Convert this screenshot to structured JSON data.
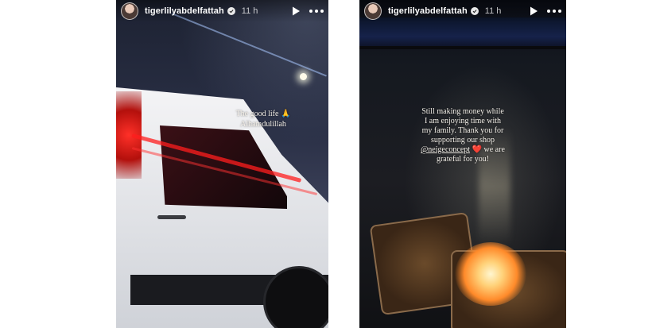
{
  "stories": [
    {
      "username": "tigerlilyabdelfattah",
      "time": "11 h",
      "caption_lines": [
        "The good life 🙏",
        "Alhamdulillah"
      ]
    },
    {
      "username": "tigerlilyabdelfattah",
      "time": "11 h",
      "caption": {
        "line1": "Still making money while",
        "line2": "I am enjoying time with",
        "line3": "my family. Thank you for",
        "line4": "supporting our shop",
        "mention": "@neigeconcept",
        "heart": "❤️",
        "line5_tail": " we are",
        "line6": "grateful for you!"
      }
    }
  ],
  "icons": {
    "play": "play-icon",
    "more": "more-icon",
    "verified": "verified-badge-icon"
  },
  "colors": {
    "heart": "#e0245e"
  }
}
